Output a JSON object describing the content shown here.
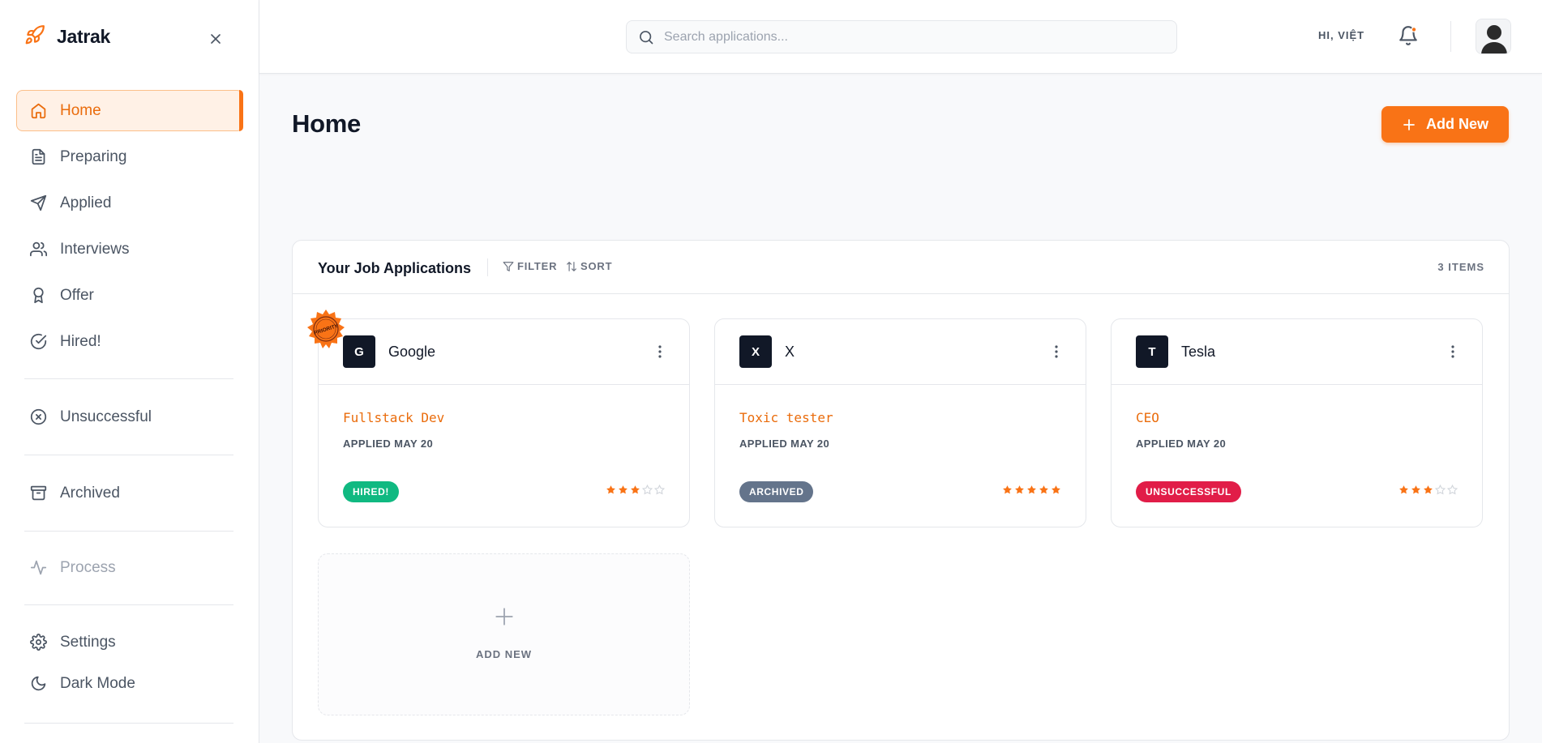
{
  "app": {
    "name": "Jatrak"
  },
  "sidebar": {
    "items": [
      {
        "label": "Home",
        "icon": "home-icon"
      },
      {
        "label": "Preparing",
        "icon": "document-icon"
      },
      {
        "label": "Applied",
        "icon": "send-icon"
      },
      {
        "label": "Interviews",
        "icon": "users-icon"
      },
      {
        "label": "Offer",
        "icon": "award-icon"
      },
      {
        "label": "Hired!",
        "icon": "check-circle-icon"
      },
      {
        "label": "Unsuccessful",
        "icon": "x-circle-icon"
      },
      {
        "label": "Archived",
        "icon": "archive-icon"
      },
      {
        "label": "Process",
        "icon": "activity-icon"
      },
      {
        "label": "Settings",
        "icon": "gear-icon"
      },
      {
        "label": "Dark Mode",
        "icon": "moon-icon"
      }
    ],
    "active": "Home"
  },
  "header": {
    "search_placeholder": "Search applications...",
    "greeting": "HI, VIỆT"
  },
  "main": {
    "title": "Home",
    "add_new_label": "Add New"
  },
  "panel": {
    "title": "Your Job Applications",
    "filter_label": "FILTER",
    "sort_label": "SORT",
    "count_label": "3 ITEMS",
    "priority_label": "PRIORITY",
    "cards": [
      {
        "initial": "G",
        "company": "Google",
        "role": "Fullstack Dev",
        "applied": "APPLIED MAY 20",
        "status": "HIRED!",
        "status_color": "#10b981",
        "rating": 3,
        "rating_max": 5
      },
      {
        "initial": "X",
        "company": "X",
        "role": "Toxic tester",
        "applied": "APPLIED MAY 20",
        "status": "ARCHIVED",
        "status_color": "#64748b",
        "rating": 5,
        "rating_max": 5
      },
      {
        "initial": "T",
        "company": "Tesla",
        "role": "CEO",
        "applied": "APPLIED MAY 20",
        "status": "UNSUCCESSFUL",
        "status_color": "#e11d48",
        "rating": 3,
        "rating_max": 5
      }
    ],
    "add_card_label": "ADD NEW"
  },
  "colors": {
    "accent": "#f97316",
    "accent_text": "#ea6c0c"
  }
}
